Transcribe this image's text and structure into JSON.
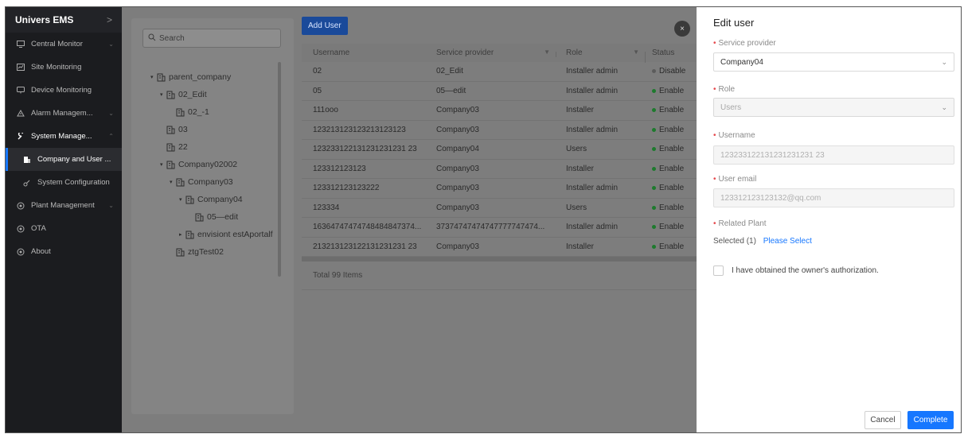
{
  "sidebar": {
    "brand": "Univers EMS",
    "items": [
      {
        "label": "Central Monitor",
        "icon": "monitor-icon",
        "caret": "⌄"
      },
      {
        "label": "Site Monitoring",
        "icon": "chart-icon",
        "caret": ""
      },
      {
        "label": "Device Monitoring",
        "icon": "display-icon",
        "caret": ""
      },
      {
        "label": "Alarm Managem...",
        "icon": "alarm-icon",
        "caret": "⌄"
      },
      {
        "label": "System Manage...",
        "icon": "wrench-icon",
        "caret": "⌃"
      },
      {
        "label": "Company and User ...",
        "icon": "company-icon",
        "caret": ""
      },
      {
        "label": "System Configuration",
        "icon": "config-icon",
        "caret": ""
      },
      {
        "label": "Plant Management",
        "icon": "plant-icon",
        "caret": "⌄"
      },
      {
        "label": "OTA",
        "icon": "ota-icon",
        "caret": ""
      },
      {
        "label": "About",
        "icon": "about-icon",
        "caret": ""
      }
    ]
  },
  "tree": {
    "search_placeholder": "Search",
    "nodes": [
      {
        "label": "parent_company",
        "depth": 0,
        "arrow": "▾"
      },
      {
        "label": "02_Edit",
        "depth": 1,
        "arrow": "▾"
      },
      {
        "label": "02_-1",
        "depth": 2,
        "arrow": ""
      },
      {
        "label": "03",
        "depth": 1,
        "arrow": ""
      },
      {
        "label": "22",
        "depth": 1,
        "arrow": ""
      },
      {
        "label": "Company02002",
        "depth": 1,
        "arrow": "▾"
      },
      {
        "label": "Company03",
        "depth": 2,
        "arrow": "▾"
      },
      {
        "label": "Company04",
        "depth": 3,
        "arrow": "▾"
      },
      {
        "label": "05—edit",
        "depth": 4,
        "arrow": ""
      },
      {
        "label": "envisiont estAportalf",
        "depth": 3,
        "arrow": "▸"
      },
      {
        "label": "ztgTest02",
        "depth": 2,
        "arrow": ""
      }
    ]
  },
  "toolbar": {
    "add_user": "Add User",
    "close": "×"
  },
  "table": {
    "headers": {
      "username": "Username",
      "service_provider": "Service provider",
      "role": "Role",
      "status": "Status"
    },
    "rows": [
      {
        "username": "02",
        "provider": "02_Edit",
        "role": "Installer admin",
        "status": "Disable",
        "status_color": "grey"
      },
      {
        "username": "05",
        "provider": "05—edit",
        "role": "Installer admin",
        "status": "Enable",
        "status_color": "green"
      },
      {
        "username": "111ooo",
        "provider": "Company03",
        "role": "Installer",
        "status": "Enable",
        "status_color": "green"
      },
      {
        "username": "123213123123213123123",
        "provider": "Company03",
        "role": "Installer admin",
        "status": "Enable",
        "status_color": "green"
      },
      {
        "username": "123233122131231231231 23",
        "provider": "Company04",
        "role": "Users",
        "status": "Enable",
        "status_color": "green"
      },
      {
        "username": "123312123123",
        "provider": "Company03",
        "role": "Installer",
        "status": "Enable",
        "status_color": "green"
      },
      {
        "username": "123312123123222",
        "provider": "Company03",
        "role": "Installer admin",
        "status": "Enable",
        "status_color": "green"
      },
      {
        "username": "123334",
        "provider": "Company03",
        "role": "Users",
        "status": "Enable",
        "status_color": "green"
      },
      {
        "username": "16364747474748484847374...",
        "provider": "37374747474747777747474...",
        "role": "Installer admin",
        "status": "Enable",
        "status_color": "green"
      },
      {
        "username": "213213123122131231231 23",
        "provider": "Company03",
        "role": "Installer",
        "status": "Enable",
        "status_color": "green"
      }
    ],
    "total": "Total 99 Items"
  },
  "drawer": {
    "title": "Edit user",
    "service_provider_label": "Service provider",
    "service_provider_value": "Company04",
    "role_label": "Role",
    "role_value": "Users",
    "username_label": "Username",
    "username_value": "123233122131231231231 23",
    "email_label": "User email",
    "email_value": "123312123123132@qq.com",
    "plant_label": "Related Plant",
    "selected_text": "Selected (1)",
    "please_select": "Please Select",
    "authorization_text": "I have obtained the owner's authorization.",
    "cancel": "Cancel",
    "complete": "Complete"
  },
  "colors": {
    "accent": "#1677ff",
    "enable": "#52c41a",
    "required": "#e5484d"
  }
}
